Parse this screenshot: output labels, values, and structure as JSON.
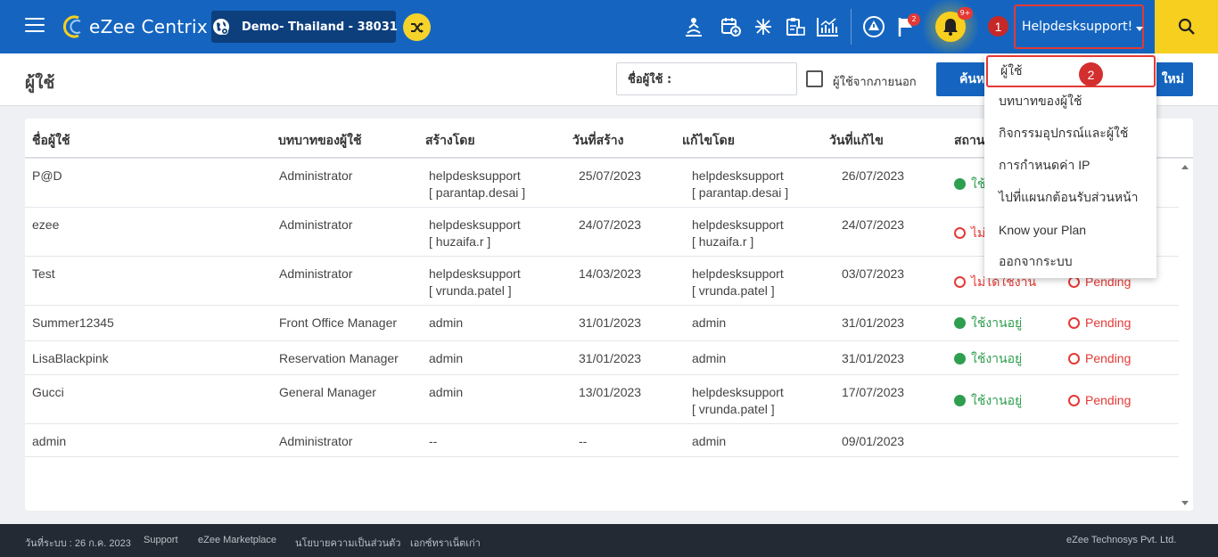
{
  "header": {
    "logo_text": "eZee Centrix",
    "property_name": "Demo- Thailand -  38031",
    "flag_badge": "2",
    "bell_badge": "9+",
    "step1": "1",
    "step2": "2",
    "user_name": "Helpdesksupport!",
    "colors": {
      "primary": "#1565c0",
      "accent": "#f7cf1f",
      "alert": "#e53935"
    },
    "icons": [
      "menu-icon",
      "property-globe-icon",
      "shuffle-icon",
      "housekeeping-icon",
      "calendar-add-icon",
      "network-icon",
      "clipboard-icon",
      "chart-icon",
      "alert-triangle-icon",
      "flag-icon",
      "bell-icon",
      "search-icon"
    ]
  },
  "subheader": {
    "title": "ผู้ใช้",
    "name_field_value": "ชื่อผู้ใช้ :",
    "external_label": "ผู้ใช้จากภายนอก",
    "search_button": "ค้นห",
    "new_button": "ใหม่"
  },
  "table": {
    "headers": [
      "ชื่อผู้ใช้",
      "บทบาทของผู้ใช้",
      "สร้างโดย",
      "วันที่สร้าง",
      "แก้ไขโดย",
      "วันที่แก้ไข",
      "สถาน"
    ],
    "rows": [
      {
        "name": "P@D",
        "role": "Administrator",
        "created_by": "helpdesksupport",
        "created_by_sub": "[ parantap.desai ]",
        "created_date": "25/07/2023",
        "modified_by": "helpdesksupport",
        "modified_by_sub": "[ parantap.desai ]",
        "modified_date": "26/07/2023",
        "status": "ใช้",
        "status_type": "active",
        "approval": ""
      },
      {
        "name": "ezee",
        "role": "Administrator",
        "created_by": "helpdesksupport",
        "created_by_sub": "[ huzaifa.r ]",
        "created_date": "24/07/2023",
        "modified_by": "helpdesksupport",
        "modified_by_sub": "[ huzaifa.r ]",
        "modified_date": "24/07/2023",
        "status": "ไม่",
        "status_type": "inactive",
        "approval": ""
      },
      {
        "name": "Test",
        "role": "Administrator",
        "created_by": "helpdesksupport",
        "created_by_sub": "[ vrunda.patel ]",
        "created_date": "14/03/2023",
        "modified_by": "helpdesksupport",
        "modified_by_sub": "[ vrunda.patel ]",
        "modified_date": "03/07/2023",
        "status": "ไม่ได้ใช้งาน",
        "status_type": "inactive",
        "approval": "Pending"
      },
      {
        "name": "Summer12345",
        "role": "Front Office Manager",
        "created_by": "admin",
        "created_by_sub": "",
        "created_date": "31/01/2023",
        "modified_by": "admin",
        "modified_by_sub": "",
        "modified_date": "31/01/2023",
        "status": "ใช้งานอยู่",
        "status_type": "active",
        "approval": "Pending"
      },
      {
        "name": "LisaBlackpink",
        "role": "Reservation Manager",
        "created_by": "admin",
        "created_by_sub": "",
        "created_date": "31/01/2023",
        "modified_by": "admin",
        "modified_by_sub": "",
        "modified_date": "31/01/2023",
        "status": "ใช้งานอยู่",
        "status_type": "active",
        "approval": "Pending"
      },
      {
        "name": "Gucci",
        "role": "General Manager",
        "created_by": "admin",
        "created_by_sub": "",
        "created_date": "13/01/2023",
        "modified_by": "helpdesksupport",
        "modified_by_sub": "[ vrunda.patel ]",
        "modified_date": "17/07/2023",
        "status": "ใช้งานอยู่",
        "status_type": "active",
        "approval": "Pending"
      },
      {
        "name": "admin",
        "role": "Administrator",
        "created_by": "--",
        "created_by_sub": "",
        "created_date": "--",
        "modified_by": "admin",
        "modified_by_sub": "",
        "modified_date": "09/01/2023",
        "status": "",
        "status_type": "none",
        "approval": ""
      }
    ]
  },
  "dropdown": {
    "items": [
      "ผู้ใช้",
      "บทบาทของผู้ใช้",
      "กิจกรรมอุปกรณ์และผู้ใช้",
      "การกำหนดค่า IP",
      "ไปที่แผนกต้อนรับส่วนหน้า",
      "Know your Plan",
      "ออกจากระบบ"
    ]
  },
  "footer": {
    "date": "วันที่ระบบ : 26 ก.ค. 2023",
    "support": "Support",
    "marketplace": "eZee Marketplace",
    "privacy": "นโยบายความเป็นส่วนตัว",
    "old_docs": "เอกซ์ทราเน็ตเก่า",
    "company": "eZee Technosys Pvt. Ltd."
  }
}
